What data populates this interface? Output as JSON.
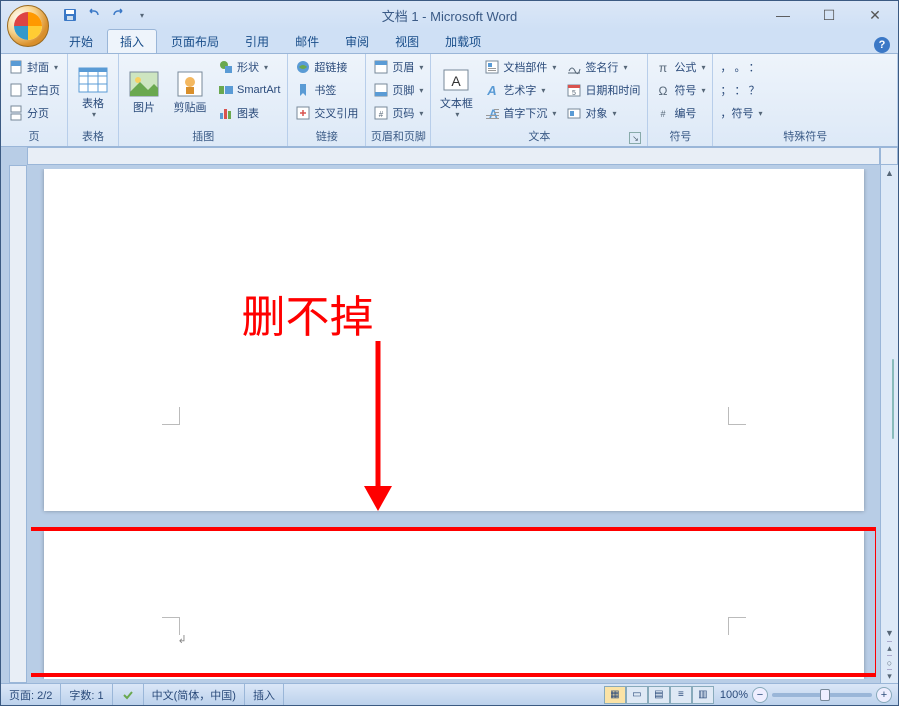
{
  "title": "文档 1 - Microsoft Word",
  "qat": {
    "save": "save",
    "undo": "undo",
    "redo": "redo"
  },
  "tabs": {
    "items": [
      {
        "label": "开始"
      },
      {
        "label": "插入"
      },
      {
        "label": "页面布局"
      },
      {
        "label": "引用"
      },
      {
        "label": "邮件"
      },
      {
        "label": "审阅"
      },
      {
        "label": "视图"
      },
      {
        "label": "加载项"
      }
    ],
    "active": 1
  },
  "ribbon": {
    "groups": [
      {
        "label": "页",
        "items": [
          {
            "label": "封面",
            "icon": "cover-page"
          },
          {
            "label": "空白页",
            "icon": "blank-page"
          },
          {
            "label": "分页",
            "icon": "page-break"
          }
        ]
      },
      {
        "label": "表格",
        "big": {
          "label": "表格",
          "icon": "table"
        }
      },
      {
        "label": "插图",
        "big": [
          {
            "label": "图片",
            "icon": "picture"
          },
          {
            "label": "剪贴画",
            "icon": "clipart"
          }
        ],
        "items": [
          {
            "label": "形状",
            "icon": "shapes"
          },
          {
            "label": "SmartArt",
            "icon": "smartart"
          },
          {
            "label": "图表",
            "icon": "chart"
          }
        ]
      },
      {
        "label": "链接",
        "items": [
          {
            "label": "超链接",
            "icon": "hyperlink"
          },
          {
            "label": "书签",
            "icon": "bookmark"
          },
          {
            "label": "交叉引用",
            "icon": "cross-ref"
          }
        ]
      },
      {
        "label": "页眉和页脚",
        "items": [
          {
            "label": "页眉",
            "icon": "header"
          },
          {
            "label": "页脚",
            "icon": "footer"
          },
          {
            "label": "页码",
            "icon": "page-number"
          }
        ]
      },
      {
        "label": "文本",
        "big": {
          "label": "文本框",
          "icon": "textbox"
        },
        "col1": [
          {
            "label": "文档部件",
            "icon": "quick-parts"
          },
          {
            "label": "艺术字",
            "icon": "wordart"
          },
          {
            "label": "首字下沉",
            "icon": "drop-cap"
          }
        ],
        "col2": [
          {
            "label": "签名行",
            "icon": "signature"
          },
          {
            "label": "日期和时间",
            "icon": "datetime"
          },
          {
            "label": "对象",
            "icon": "object"
          }
        ]
      },
      {
        "label": "符号",
        "items": [
          {
            "label": "公式",
            "icon": "equation"
          },
          {
            "label": "符号",
            "icon": "symbol"
          },
          {
            "label": "编号",
            "icon": "numbering"
          }
        ]
      },
      {
        "label": "特殊符号",
        "items": [
          {
            "label": "，  。  ："
          },
          {
            "label": "；  ：  ？"
          },
          {
            "label": "，符号"
          }
        ]
      }
    ]
  },
  "annotation": {
    "text": "删不掉"
  },
  "status": {
    "page": "页面: 2/2",
    "words": "字数: 1",
    "language": "中文(简体，中国)",
    "mode": "插入",
    "zoom": "100%"
  }
}
